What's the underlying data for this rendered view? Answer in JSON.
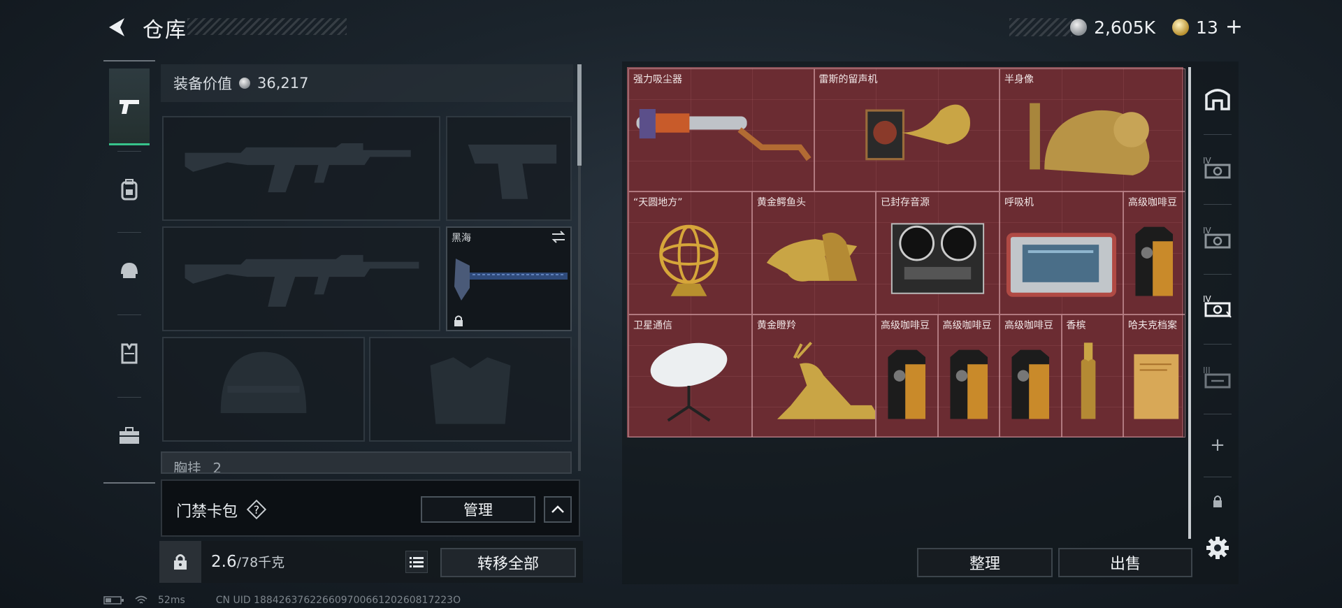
{
  "header": {
    "title": "仓库",
    "currencies": [
      {
        "icon": "silver-coin-icon",
        "value": "2,605K"
      },
      {
        "icon": "gold-coin-icon",
        "value": "13"
      }
    ],
    "add_symbol": "+"
  },
  "categories": [
    {
      "icon": "pistol-icon",
      "active": true
    },
    {
      "icon": "backpack-icon",
      "active": false
    },
    {
      "icon": "helmet-icon",
      "active": false
    },
    {
      "icon": "vest-icon",
      "active": false
    },
    {
      "icon": "briefcase-icon",
      "active": false
    }
  ],
  "equipment": {
    "value_label": "装备价值",
    "value": "36,217",
    "melee_name": "黑海",
    "chest_label": "胸挂",
    "chest_value": "2"
  },
  "keycard": {
    "label": "门禁卡包",
    "help": "?",
    "manage_label": "管理"
  },
  "bottom_left": {
    "weight_value": "2.6",
    "weight_capacity": "/78千克",
    "transfer_all_label": "转移全部"
  },
  "storage": {
    "items": [
      {
        "name": "强力吸尘器",
        "icon": "vacuum-cleaner-icon"
      },
      {
        "name": "雷斯的留声机",
        "icon": "gramophone-icon"
      },
      {
        "name": "半身像",
        "icon": "bust-statue-icon"
      },
      {
        "name": "“天圆地方”",
        "icon": "armillary-sphere-icon"
      },
      {
        "name": "黄金鳄鱼头",
        "icon": "golden-crocodile-head-icon"
      },
      {
        "name": "已封存音源",
        "icon": "reel-tape-recorder-icon"
      },
      {
        "name": "呼吸机",
        "icon": "ventilator-icon"
      },
      {
        "name": "高级咖啡豆",
        "icon": "coffee-bag-icon"
      },
      {
        "name": "卫星通信",
        "icon": "satellite-dish-icon"
      },
      {
        "name": "黄金瞪羚",
        "icon": "golden-gazelle-icon"
      },
      {
        "name": "高级咖啡豆",
        "icon": "coffee-bag-icon"
      },
      {
        "name": "高级咖啡豆",
        "icon": "coffee-bag-icon"
      },
      {
        "name": "高级咖啡豆",
        "icon": "coffee-bag-icon"
      },
      {
        "name": "香槟",
        "icon": "champagne-bottle-icon"
      },
      {
        "name": "哈夫克档案",
        "icon": "archive-folder-icon"
      }
    ],
    "tabs": [
      {
        "icon": "storage-main-icon"
      },
      {
        "icon": "storage-case-iv-icon",
        "label": "IV"
      },
      {
        "icon": "storage-case-iv-icon",
        "label": "IV"
      },
      {
        "icon": "storage-case-iv-icon",
        "label": "IV"
      },
      {
        "icon": "storage-case-iii-icon",
        "label": "III"
      },
      {
        "icon": "add-storage-icon",
        "label": "+"
      },
      {
        "icon": "lock-icon"
      },
      {
        "icon": "settings-gear-icon"
      }
    ],
    "sort_label": "整理",
    "sell_label": "出售"
  },
  "status_bar": {
    "ping": "52ms",
    "uid": "CN UID 18842637622660970066120260817223O"
  }
}
